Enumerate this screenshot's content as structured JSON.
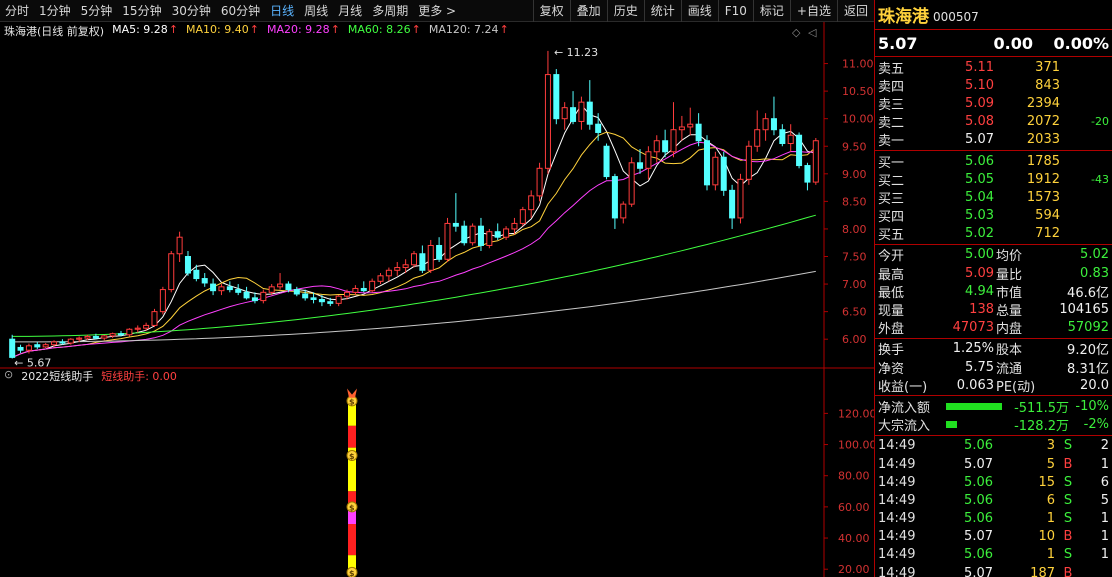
{
  "toolbar": {
    "left": [
      "分时",
      "1分钟",
      "5分钟",
      "15分钟",
      "30分钟",
      "60分钟",
      "日线",
      "周线",
      "月线",
      "多周期",
      "更多 >"
    ],
    "active": "日线",
    "right": [
      "复权",
      "叠加",
      "历史",
      "统计",
      "画线",
      "F10",
      "标记",
      "+自选",
      "返回"
    ],
    "nav_icons": [
      "◇",
      "◁"
    ]
  },
  "legend": {
    "stock": "珠海港(日线 前复权)",
    "ma": [
      {
        "label": "MA5: 9.28",
        "color": "#ffffff"
      },
      {
        "label": "MA10: 9.40",
        "color": "#ffd23c"
      },
      {
        "label": "MA20: 9.28",
        "color": "#ff40ff"
      },
      {
        "label": "MA60: 8.26",
        "color": "#40ff40"
      },
      {
        "label": "MA120: 7.24",
        "color": "#c8c8c8"
      }
    ],
    "sub_title": "2022短线助手",
    "sub_value": "短线助手: 0.00"
  },
  "chart_data": {
    "type": "candlestick",
    "y_ticks": [
      "11.00",
      "10.50",
      "10.00",
      "9.50",
      "9.00",
      "8.50",
      "8.00",
      "7.50",
      "7.00",
      "6.50",
      "6.00"
    ],
    "y_range": [
      5.55,
      11.5
    ],
    "sub_ticks": [
      "120.00",
      "100.00",
      "80.00",
      "60.00",
      "40.00",
      "20.00"
    ],
    "sub_range": [
      15,
      135
    ],
    "annotations": {
      "high": "11.23",
      "low": "5.67"
    },
    "candles": [
      [
        6.0,
        6.08,
        5.65,
        5.67
      ],
      [
        5.85,
        5.9,
        5.75,
        5.8
      ],
      [
        5.8,
        5.92,
        5.74,
        5.88
      ],
      [
        5.9,
        5.95,
        5.82,
        5.86
      ],
      [
        5.86,
        5.93,
        5.84,
        5.9
      ],
      [
        5.9,
        5.98,
        5.86,
        5.95
      ],
      [
        5.95,
        6.0,
        5.9,
        5.93
      ],
      [
        5.93,
        6.02,
        5.9,
        6.0
      ],
      [
        6.0,
        6.05,
        5.95,
        6.02
      ],
      [
        6.02,
        6.08,
        5.98,
        6.05
      ],
      [
        6.05,
        6.1,
        6.0,
        6.02
      ],
      [
        6.02,
        6.08,
        5.98,
        6.06
      ],
      [
        6.06,
        6.12,
        6.02,
        6.1
      ],
      [
        6.1,
        6.15,
        6.05,
        6.08
      ],
      [
        6.08,
        6.2,
        6.05,
        6.18
      ],
      [
        6.18,
        6.25,
        6.12,
        6.2
      ],
      [
        6.2,
        6.3,
        6.15,
        6.25
      ],
      [
        6.25,
        6.55,
        6.22,
        6.5
      ],
      [
        6.5,
        6.95,
        6.45,
        6.9
      ],
      [
        6.9,
        7.6,
        6.85,
        7.55
      ],
      [
        7.55,
        7.95,
        7.4,
        7.85
      ],
      [
        7.5,
        7.6,
        7.15,
        7.2
      ],
      [
        7.25,
        7.35,
        7.05,
        7.1
      ],
      [
        7.1,
        7.2,
        6.95,
        7.02
      ],
      [
        7.0,
        7.1,
        6.8,
        6.88
      ],
      [
        6.88,
        7.0,
        6.8,
        6.95
      ],
      [
        6.95,
        7.05,
        6.85,
        6.9
      ],
      [
        6.9,
        7.0,
        6.8,
        6.85
      ],
      [
        6.85,
        6.95,
        6.72,
        6.75
      ],
      [
        6.75,
        6.85,
        6.65,
        6.7
      ],
      [
        6.7,
        6.9,
        6.65,
        6.85
      ],
      [
        6.85,
        7.0,
        6.8,
        6.95
      ],
      [
        6.95,
        7.2,
        6.9,
        7.0
      ],
      [
        7.0,
        7.05,
        6.85,
        6.9
      ],
      [
        6.9,
        6.95,
        6.78,
        6.82
      ],
      [
        6.82,
        6.9,
        6.7,
        6.75
      ],
      [
        6.75,
        6.85,
        6.65,
        6.72
      ],
      [
        6.72,
        6.8,
        6.6,
        6.68
      ],
      [
        6.68,
        6.75,
        6.6,
        6.65
      ],
      [
        6.65,
        6.8,
        6.6,
        6.78
      ],
      [
        6.78,
        6.9,
        6.72,
        6.85
      ],
      [
        6.85,
        6.98,
        6.8,
        6.92
      ],
      [
        6.92,
        7.05,
        6.85,
        6.88
      ],
      [
        6.88,
        7.1,
        6.85,
        7.05
      ],
      [
        7.05,
        7.2,
        7.0,
        7.15
      ],
      [
        7.15,
        7.3,
        7.05,
        7.25
      ],
      [
        7.25,
        7.4,
        7.15,
        7.3
      ],
      [
        7.3,
        7.45,
        7.2,
        7.35
      ],
      [
        7.35,
        7.6,
        7.3,
        7.55
      ],
      [
        7.55,
        7.7,
        7.2,
        7.25
      ],
      [
        7.25,
        7.8,
        7.2,
        7.7
      ],
      [
        7.7,
        7.85,
        7.4,
        7.45
      ],
      [
        7.45,
        8.2,
        7.4,
        8.1
      ],
      [
        8.1,
        8.65,
        7.95,
        8.05
      ],
      [
        8.05,
        8.15,
        7.7,
        7.75
      ],
      [
        7.75,
        8.1,
        7.7,
        8.05
      ],
      [
        8.05,
        8.2,
        7.6,
        7.7
      ],
      [
        7.7,
        8.0,
        7.65,
        7.95
      ],
      [
        7.95,
        8.1,
        7.8,
        7.85
      ],
      [
        7.85,
        8.05,
        7.8,
        8.0
      ],
      [
        8.0,
        8.2,
        7.9,
        8.1
      ],
      [
        8.1,
        8.4,
        8.05,
        8.35
      ],
      [
        8.35,
        8.7,
        8.2,
        8.6
      ],
      [
        8.6,
        9.2,
        8.5,
        9.1
      ],
      [
        9.1,
        11.23,
        9.0,
        10.8
      ],
      [
        10.8,
        10.9,
        9.9,
        10.0
      ],
      [
        10.0,
        10.3,
        9.8,
        10.2
      ],
      [
        10.2,
        10.5,
        9.9,
        9.95
      ],
      [
        9.95,
        10.4,
        9.8,
        10.3
      ],
      [
        10.3,
        10.7,
        9.8,
        9.9
      ],
      [
        9.9,
        10.1,
        9.6,
        9.75
      ],
      [
        9.5,
        9.55,
        8.9,
        8.95
      ],
      [
        8.95,
        9.0,
        8.0,
        8.2
      ],
      [
        8.2,
        8.5,
        8.1,
        8.45
      ],
      [
        8.45,
        9.3,
        8.4,
        9.2
      ],
      [
        9.2,
        9.45,
        9.0,
        9.1
      ],
      [
        9.1,
        9.5,
        8.9,
        9.4
      ],
      [
        9.4,
        9.7,
        9.2,
        9.6
      ],
      [
        9.6,
        9.8,
        9.3,
        9.4
      ],
      [
        9.4,
        10.3,
        9.3,
        9.8
      ],
      [
        9.8,
        10.05,
        9.6,
        9.85
      ],
      [
        9.85,
        10.2,
        9.7,
        9.9
      ],
      [
        9.9,
        10.1,
        9.5,
        9.6
      ],
      [
        9.6,
        9.7,
        8.7,
        8.8
      ],
      [
        8.8,
        9.4,
        8.7,
        9.3
      ],
      [
        9.3,
        9.4,
        8.6,
        8.7
      ],
      [
        8.7,
        8.8,
        8.0,
        8.2
      ],
      [
        8.2,
        9.0,
        8.1,
        8.9
      ],
      [
        8.9,
        9.6,
        8.8,
        9.5
      ],
      [
        9.5,
        10.15,
        9.4,
        9.8
      ],
      [
        9.8,
        10.1,
        9.6,
        10.0
      ],
      [
        10.0,
        10.4,
        9.7,
        9.8
      ],
      [
        9.8,
        9.9,
        9.5,
        9.55
      ],
      [
        9.55,
        9.9,
        9.4,
        9.7
      ],
      [
        9.7,
        9.75,
        9.1,
        9.15
      ],
      [
        9.15,
        9.2,
        8.7,
        8.85
      ],
      [
        8.85,
        9.65,
        8.8,
        9.6
      ]
    ]
  },
  "panel": {
    "name": "珠海港",
    "code": "000507",
    "price": "5.07",
    "change": "0.00",
    "pct": "0.00%",
    "asks": [
      {
        "label": "卖五",
        "price": "5.11",
        "vol": "371",
        "chg": ""
      },
      {
        "label": "卖四",
        "price": "5.10",
        "vol": "843",
        "chg": ""
      },
      {
        "label": "卖三",
        "price": "5.09",
        "vol": "2394",
        "chg": ""
      },
      {
        "label": "卖二",
        "price": "5.08",
        "vol": "2072",
        "chg": "-20"
      },
      {
        "label": "卖一",
        "price": "5.07",
        "vol": "2033",
        "chg": ""
      }
    ],
    "bids": [
      {
        "label": "买一",
        "price": "5.06",
        "vol": "1785",
        "chg": ""
      },
      {
        "label": "买二",
        "price": "5.05",
        "vol": "1912",
        "chg": "-43"
      },
      {
        "label": "买三",
        "price": "5.04",
        "vol": "1573",
        "chg": ""
      },
      {
        "label": "买四",
        "price": "5.03",
        "vol": "594",
        "chg": ""
      },
      {
        "label": "买五",
        "price": "5.02",
        "vol": "712",
        "chg": ""
      }
    ],
    "stats": [
      [
        "今开",
        "5.00",
        "均价",
        "5.02"
      ],
      [
        "最高",
        "5.09",
        "量比",
        "0.83"
      ],
      [
        "最低",
        "4.94",
        "市值",
        "46.6亿"
      ],
      [
        "现量",
        "138",
        "总量",
        "104165"
      ],
      [
        "外盘",
        "47073",
        "内盘",
        "57092"
      ]
    ],
    "stats2": [
      [
        "换手",
        "1.25%",
        "股本",
        "9.20亿"
      ],
      [
        "净资",
        "5.75",
        "流通",
        "8.31亿"
      ],
      [
        "收益(一)",
        "0.063",
        "PE(动)",
        "20.0"
      ]
    ],
    "flows": [
      {
        "label": "净流入额",
        "value": "-511.5万",
        "pct": "-10%",
        "bar": 1.0
      },
      {
        "label": "大宗流入",
        "value": "-128.2万",
        "pct": "-2%",
        "bar": 0.2
      }
    ],
    "ticks": [
      [
        "14:49",
        "5.06",
        "3",
        "S",
        "2"
      ],
      [
        "14:49",
        "5.07",
        "5",
        "B",
        "1"
      ],
      [
        "14:49",
        "5.06",
        "15",
        "S",
        "6"
      ],
      [
        "14:49",
        "5.06",
        "6",
        "S",
        "5"
      ],
      [
        "14:49",
        "5.06",
        "1",
        "S",
        "1"
      ],
      [
        "14:49",
        "5.07",
        "10",
        "B",
        "1"
      ],
      [
        "14:49",
        "5.06",
        "1",
        "S",
        "1"
      ],
      [
        "14:49",
        "5.07",
        "187",
        "B",
        ""
      ]
    ]
  }
}
